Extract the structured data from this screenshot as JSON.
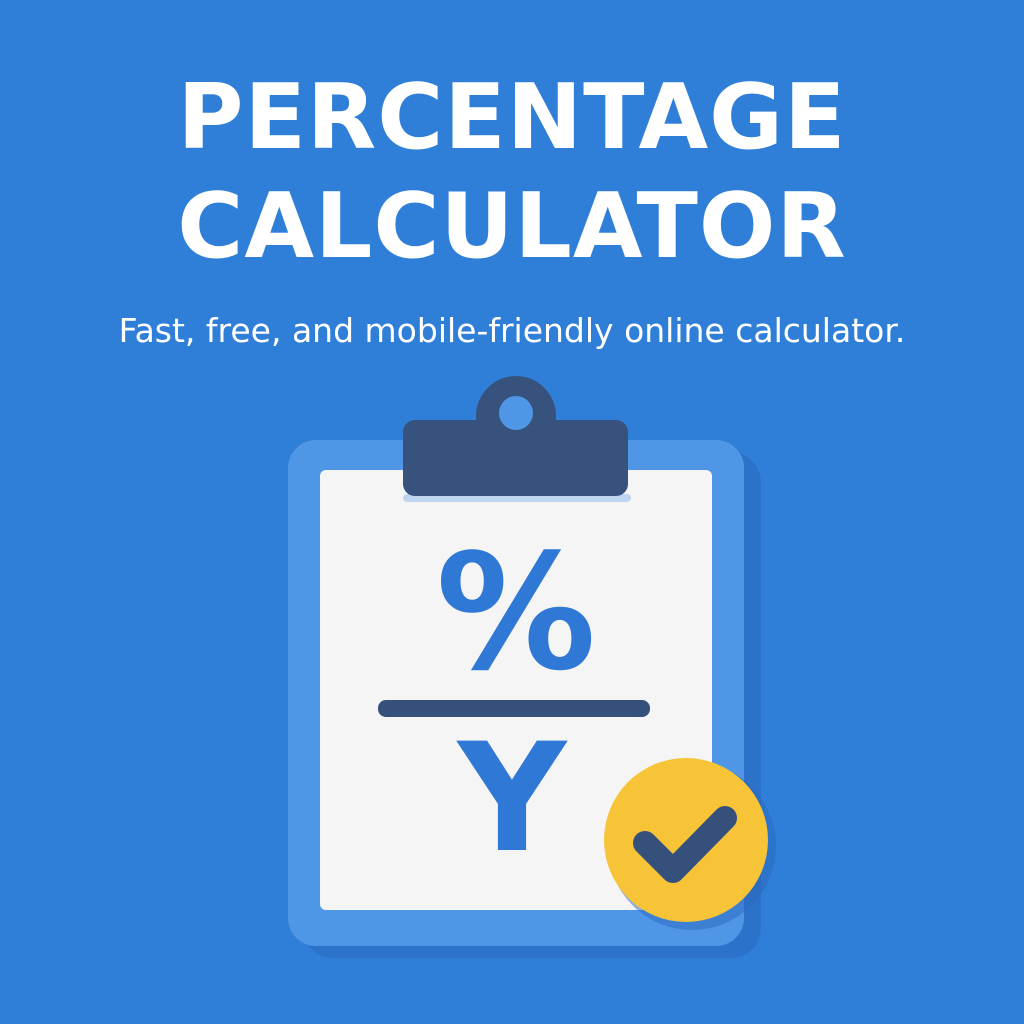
{
  "hero": {
    "title_line1": "PERCENTAGE",
    "title_line2": "CALCULATOR",
    "subtitle": "Fast, free, and mobile-friendly online calculator."
  },
  "clipboard": {
    "percent_symbol": "%",
    "variable_symbol": "Y",
    "check_icon": "check-icon",
    "clip_icon": "clipboard-clip-icon"
  },
  "colors": {
    "background": "#2f7fd8",
    "board": "#4f97e6",
    "paper": "#f5f5f5",
    "clip": "#37527d",
    "symbol": "#2f78d6",
    "badge": "#f7c437",
    "check": "#36507c"
  }
}
